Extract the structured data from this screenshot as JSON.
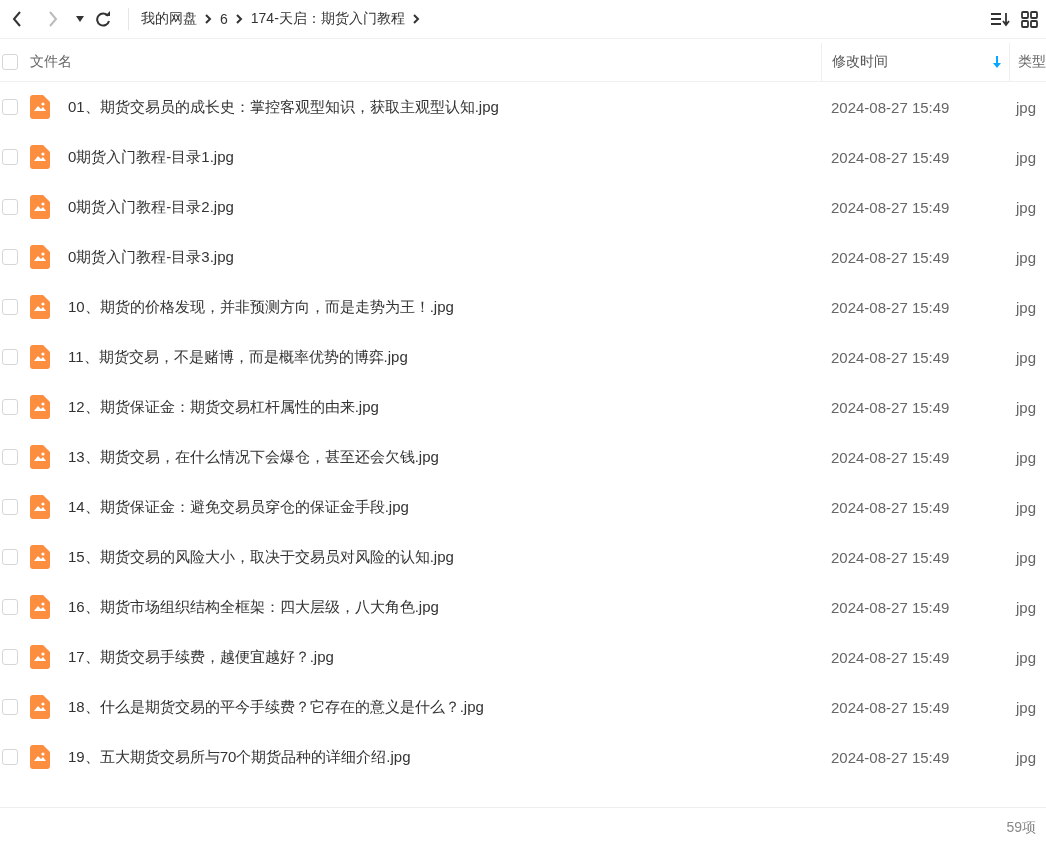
{
  "toolbar": {
    "breadcrumb": [
      "我的网盘",
      "6",
      "174-天启：期货入门教程"
    ]
  },
  "table": {
    "columns": [
      {
        "label": "文件名",
        "sorted": false
      },
      {
        "label": "修改时间",
        "sorted": true
      },
      {
        "label": "类型",
        "sorted": false
      }
    ],
    "select_all": {
      "checked": false
    },
    "rows": [
      {
        "name": "01、期货交易员的成长史：掌控客观型知识，获取主观型认知.jpg",
        "modified": "2024-08-27 15:49",
        "type": "jpg",
        "checked": false
      },
      {
        "name": "0期货入门教程-目录1.jpg",
        "modified": "2024-08-27 15:49",
        "type": "jpg",
        "checked": false
      },
      {
        "name": "0期货入门教程-目录2.jpg",
        "modified": "2024-08-27 15:49",
        "type": "jpg",
        "checked": false
      },
      {
        "name": "0期货入门教程-目录3.jpg",
        "modified": "2024-08-27 15:49",
        "type": "jpg",
        "checked": false
      },
      {
        "name": "10、期货的价格发现，并非预测方向，而是走势为王！.jpg",
        "modified": "2024-08-27 15:49",
        "type": "jpg",
        "checked": false
      },
      {
        "name": "11、期货交易，不是赌博，而是概率优势的博弈.jpg",
        "modified": "2024-08-27 15:49",
        "type": "jpg",
        "checked": false
      },
      {
        "name": "12、期货保证金：期货交易杠杆属性的由来.jpg",
        "modified": "2024-08-27 15:49",
        "type": "jpg",
        "checked": false
      },
      {
        "name": "13、期货交易，在什么情况下会爆仓，甚至还会欠钱.jpg",
        "modified": "2024-08-27 15:49",
        "type": "jpg",
        "checked": false
      },
      {
        "name": "14、期货保证金：避免交易员穿仓的保证金手段.jpg",
        "modified": "2024-08-27 15:49",
        "type": "jpg",
        "checked": false
      },
      {
        "name": "15、期货交易的风险大小，取决于交易员对风险的认知.jpg",
        "modified": "2024-08-27 15:49",
        "type": "jpg",
        "checked": false
      },
      {
        "name": "16、期货市场组织结构全框架：四大层级，八大角色.jpg",
        "modified": "2024-08-27 15:49",
        "type": "jpg",
        "checked": false
      },
      {
        "name": "17、期货交易手续费，越便宜越好？.jpg",
        "modified": "2024-08-27 15:49",
        "type": "jpg",
        "checked": false
      },
      {
        "name": "18、什么是期货交易的平今手续费？它存在的意义是什么？.jpg",
        "modified": "2024-08-27 15:49",
        "type": "jpg",
        "checked": false
      },
      {
        "name": "19、五大期货交易所与70个期货品种的详细介绍.jpg",
        "modified": "2024-08-27 15:49",
        "type": "jpg",
        "checked": false
      }
    ]
  },
  "status_bar": {
    "count": "59项"
  }
}
